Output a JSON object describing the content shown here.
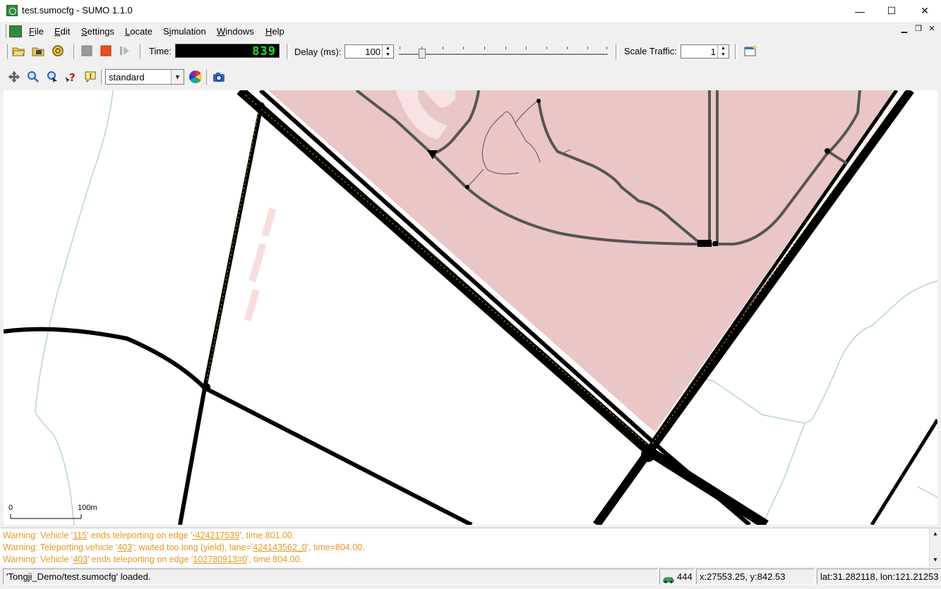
{
  "window": {
    "title": "test.sumocfg - SUMO 1.1.0",
    "minimize": "—",
    "maximize": "☐",
    "close": "✕"
  },
  "menu": {
    "items": [
      {
        "pre": "",
        "u": "F",
        "post": "ile"
      },
      {
        "pre": "",
        "u": "E",
        "post": "dit"
      },
      {
        "pre": "",
        "u": "S",
        "post": "ettings"
      },
      {
        "pre": "",
        "u": "L",
        "post": "ocate"
      },
      {
        "pre": "S",
        "u": "i",
        "post": "mulation"
      },
      {
        "pre": "",
        "u": "W",
        "post": "indows"
      },
      {
        "pre": "",
        "u": "H",
        "post": "elp"
      }
    ]
  },
  "toolbar": {
    "time_label": "Time:",
    "time_value": "839",
    "delay_label": "Delay (ms):",
    "delay_value": "100",
    "scale_label": "Scale Traffic:",
    "scale_value": "1",
    "icons": [
      "open-folder-icon",
      "open-network-icon",
      "reload-icon",
      "stop-icon",
      "run-icon",
      "step-icon",
      "new-view-icon"
    ]
  },
  "view_toolbar": {
    "scheme_value": "standard",
    "icons": [
      "recenter-icon",
      "zoom-icon",
      "locate-icon",
      "help-icon",
      "show-tooltips-icon",
      "color-wheel-icon",
      "screenshot-icon"
    ]
  },
  "scale": {
    "zero": "0",
    "label": "100m"
  },
  "log": [
    {
      "a": "Warning: Vehicle '",
      "link1": "115",
      "b": "' ends teleporting on edge '",
      "link2": "-424217539",
      "c": "', time 801.00."
    },
    {
      "a": "Warning: Teleporting vehicle '",
      "link1": "403",
      "b": "'; waited too long (yield), lane='",
      "link2": "424143562_0",
      "c": "', time=804.00."
    },
    {
      "a": "Warning: Vehicle '",
      "link1": "403",
      "b": "' ends teleporting on edge '",
      "link2": "102780913#0",
      "c": "', time 804.00."
    }
  ],
  "status": {
    "message": "'Tongji_Demo/test.sumocfg' loaded.",
    "vehicle_count": "444",
    "xy": "x:27553.25, y:842.53",
    "latlon": "lat:31.282118, lon:121.21253",
    "vehicle_icon": "car-icon"
  },
  "colors": {
    "time_digits": "#19e619",
    "warning": "#e49a20",
    "area": "#ebc6c6"
  }
}
